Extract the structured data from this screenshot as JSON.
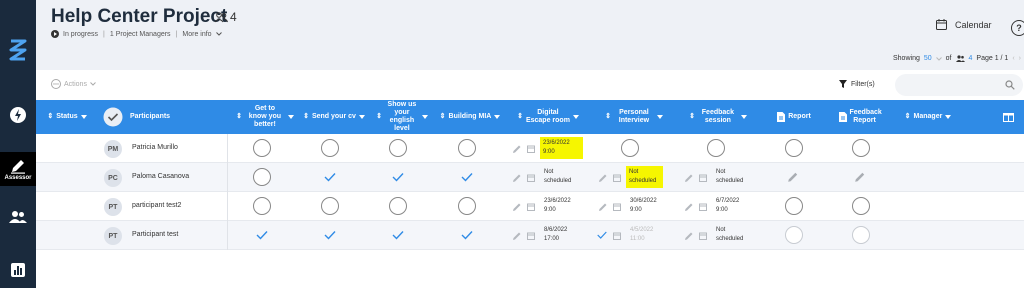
{
  "sidebar": {
    "items": [
      {
        "icon": "logo-icon"
      },
      {
        "icon": "bolt-icon"
      },
      {
        "icon": "pencil-icon",
        "label": "Assessor",
        "active": true
      },
      {
        "icon": "users-icon"
      },
      {
        "icon": "chart-icon"
      }
    ]
  },
  "header": {
    "title": "Help Center Project",
    "member_count": "4",
    "status": "In progress",
    "managers": "1 Project Managers",
    "more_info": "More info",
    "calendar_label": "Calendar",
    "help_label": "?"
  },
  "pagination": {
    "showing_label": "Showing",
    "per_page": "50",
    "of_label": "of",
    "total": "4",
    "page_text": "Page 1 / 1"
  },
  "toolbar": {
    "actions_label": "Actions",
    "filter_label": "Filter(s)",
    "search_placeholder": ""
  },
  "table": {
    "columns": [
      {
        "label": "Status"
      },
      {
        "label": "Participants"
      },
      {
        "label": "Get to know you better!"
      },
      {
        "label": "Send your cv"
      },
      {
        "label": "Show us your english level"
      },
      {
        "label": "Building MIA"
      },
      {
        "label": "Digital Escape room"
      },
      {
        "label": "Personal Interview"
      },
      {
        "label": "Feedback session"
      },
      {
        "label": "Report"
      },
      {
        "label": "Feedback Report"
      },
      {
        "label": "Manager"
      }
    ],
    "rows": [
      {
        "initials": "PM",
        "name": "Patricia Murillo",
        "get_to_know": "empty",
        "cv": "empty",
        "english": "empty",
        "mia": "empty",
        "escape_date": "23/6/2022",
        "escape_time": "9:00",
        "interview": "empty",
        "feedback": "empty",
        "report": "empty",
        "feedback_report": "empty"
      },
      {
        "initials": "PC",
        "name": "Paloma Casanova",
        "get_to_know": "empty",
        "cv": "done",
        "english": "done",
        "mia": "done",
        "escape_text": "Not scheduled",
        "interview_text": "Not scheduled",
        "feedback_text": "Not scheduled",
        "report": "edit",
        "feedback_report": "edit"
      },
      {
        "initials": "PT",
        "name": "participant test2",
        "get_to_know": "empty",
        "cv": "empty",
        "english": "empty",
        "mia": "empty",
        "escape_date": "23/6/2022",
        "escape_time": "9:00",
        "interview_date": "30/6/2022",
        "interview_time": "9:00",
        "feedback_date": "6/7/2022",
        "feedback_time": "9:00",
        "report": "empty",
        "feedback_report": "empty"
      },
      {
        "initials": "PT",
        "name": "Participant test",
        "get_to_know": "done",
        "cv": "done",
        "english": "done",
        "mia": "done",
        "escape_date": "8/6/2022",
        "escape_time": "17:00",
        "interview_date": "4/5/2022",
        "interview_time": "11:00",
        "feedback_text": "Not scheduled",
        "report": "faded",
        "feedback_report": "faded"
      }
    ]
  },
  "colors": {
    "accent": "#2f8be6",
    "sidebar": "#1a2a3d",
    "highlight": "#f6f600",
    "check": "#2f8be6"
  }
}
